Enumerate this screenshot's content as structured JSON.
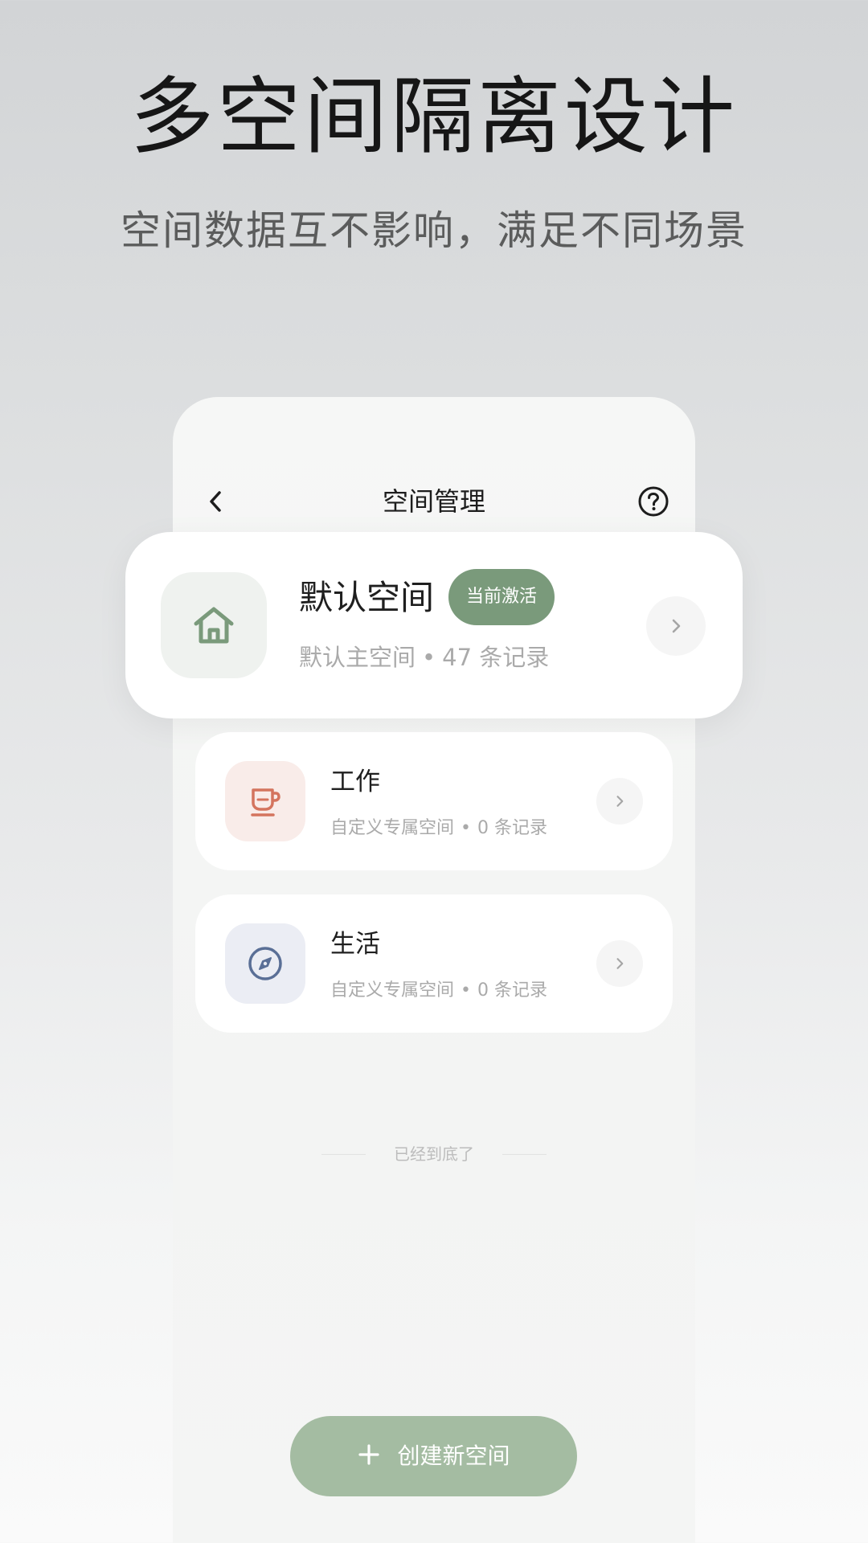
{
  "hero": {
    "title": "多空间隔离设计",
    "subtitle": "空间数据互不影响，满足不同场景"
  },
  "header": {
    "title": "空间管理",
    "back_icon": "chevron-left-icon",
    "help_icon": "help-circle-icon"
  },
  "spaces": [
    {
      "name": "默认空间",
      "badge": "当前激活",
      "type": "默认主空间",
      "separator": "•",
      "records": "47 条记录",
      "icon": "home-icon",
      "icon_color": "#7a9a7b",
      "icon_bg": "#eff2ef"
    },
    {
      "name": "工作",
      "type": "自定义专属空间",
      "separator": "•",
      "records": "0 条记录",
      "icon": "coffee-cup-icon",
      "icon_color": "#d4745e",
      "icon_bg": "#f9ece9"
    },
    {
      "name": "生活",
      "type": "自定义专属空间",
      "separator": "•",
      "records": "0 条记录",
      "icon": "compass-icon",
      "icon_color": "#5a6f96",
      "icon_bg": "#ebedf4"
    }
  ],
  "end_text": "已经到底了",
  "create_button": {
    "label": "创建新空间",
    "icon": "plus-icon"
  },
  "colors": {
    "accent": "#7a9a7b",
    "button": "#a4bca2"
  }
}
